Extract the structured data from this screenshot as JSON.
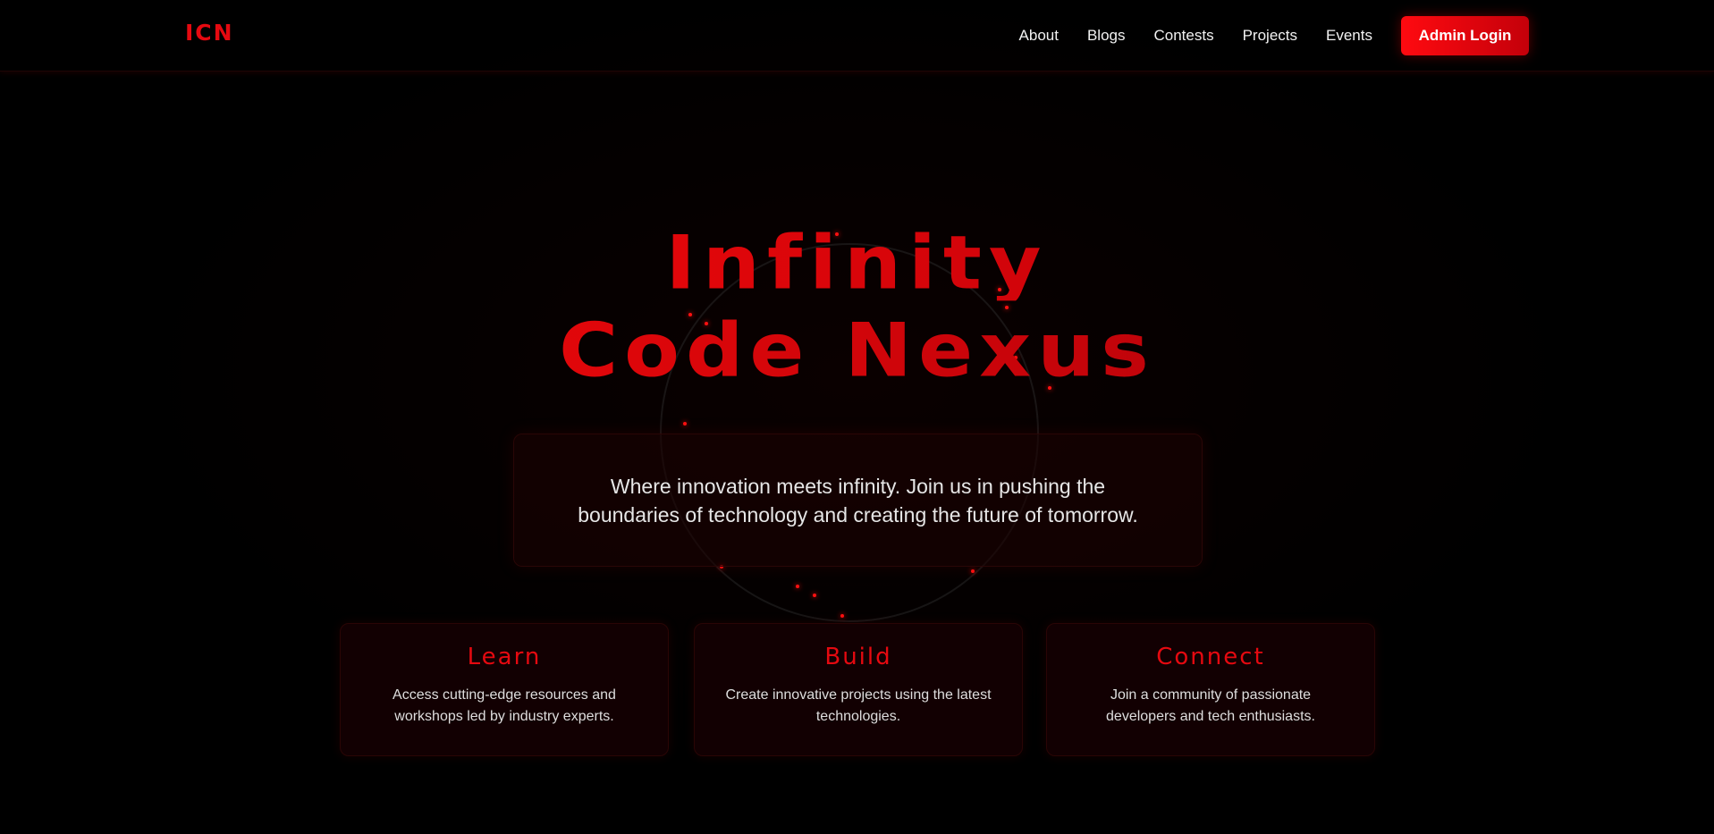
{
  "header": {
    "logo": "ICN",
    "nav": [
      "About",
      "Blogs",
      "Contests",
      "Projects",
      "Events"
    ],
    "admin_button": "Admin Login"
  },
  "hero": {
    "title_line1": "Infinity",
    "title_line2": "Code Nexus",
    "tagline": "Where innovation meets infinity. Join us in pushing the boundaries of technology and creating the future of tomorrow."
  },
  "features": [
    {
      "title": "Learn",
      "description": "Access cutting-edge resources and workshops led by industry experts."
    },
    {
      "title": "Build",
      "description": "Create innovative projects using the latest technologies."
    },
    {
      "title": "Connect",
      "description": "Join a community of passionate developers and tech enthusiasts."
    }
  ],
  "colors": {
    "accent": "#e50910",
    "background": "#000000",
    "card_background": "#120002"
  }
}
